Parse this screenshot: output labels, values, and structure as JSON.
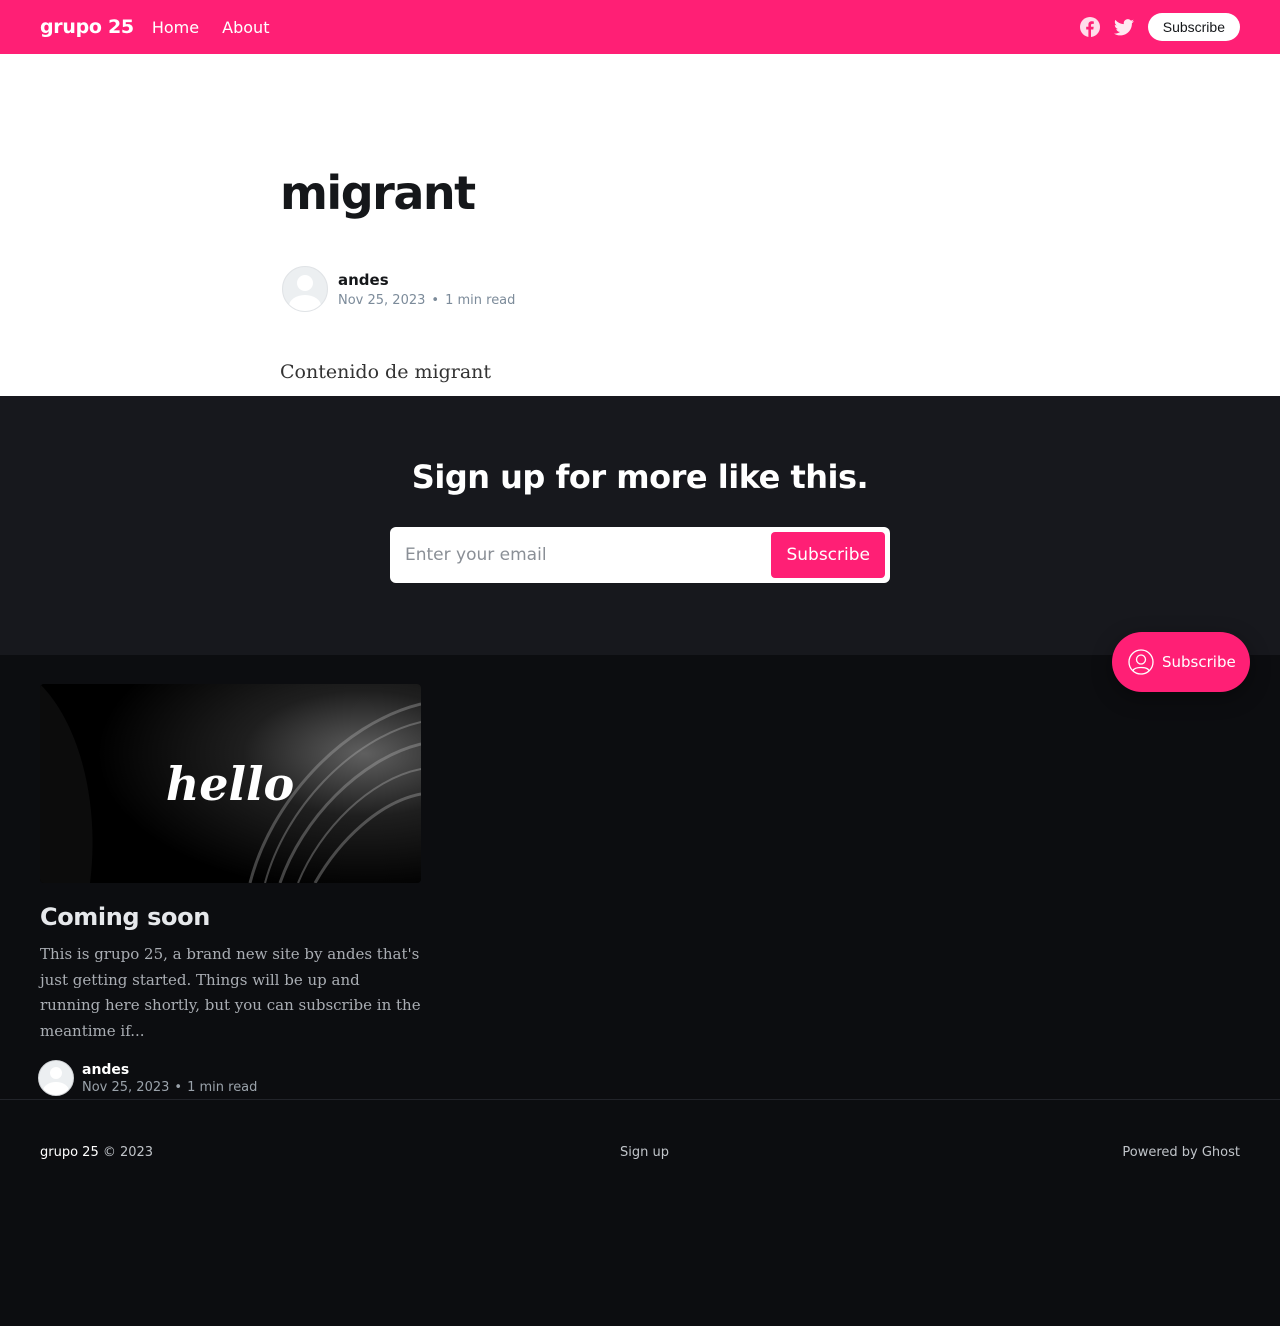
{
  "header": {
    "brand": "grupo 25",
    "nav": [
      "Home",
      "About"
    ],
    "icons": [
      "facebook-icon",
      "twitter-icon"
    ],
    "subscribe_label": "Subscribe",
    "accent_color": "#ff1f75"
  },
  "article": {
    "title": "migrant",
    "author": "andes",
    "date": "Nov 25, 2023",
    "dot": "•",
    "read_time": "1 min read",
    "content": "Contenido de migrant"
  },
  "signup": {
    "heading": "Sign up for more like this.",
    "email_placeholder": "Enter your email",
    "button_label": "Subscribe"
  },
  "portal": {
    "label": "Subscribe"
  },
  "feed": {
    "cards": [
      {
        "image_text": "hello",
        "title": "Coming soon",
        "excerpt": "This is grupo 25, a brand new site by andes that's just getting started. Things will be up and running here shortly, but you can subscribe in the meantime if...",
        "author": "andes",
        "date": "Nov 25, 2023",
        "dot": "•",
        "read_time": "1 min read"
      }
    ]
  },
  "footer": {
    "site_name": "grupo 25",
    "copyright": "© 2023",
    "signup_link": "Sign up",
    "powered_by": "Powered by Ghost"
  }
}
